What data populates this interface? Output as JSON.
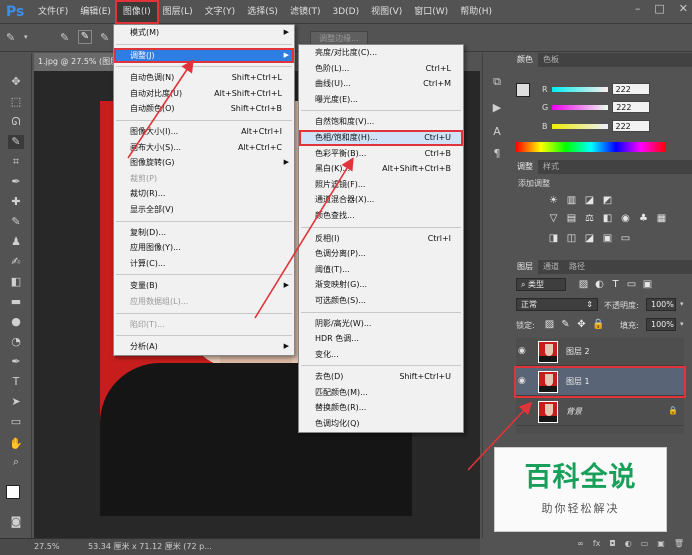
{
  "app": {
    "logo": "Ps"
  },
  "menubar": [
    "文件(F)",
    "编辑(E)",
    "图像(I)",
    "图层(L)",
    "文字(Y)",
    "选择(S)",
    "滤镜(T)",
    "3D(D)",
    "视图(V)",
    "窗口(W)",
    "帮助(H)"
  ],
  "window_controls": [
    "–",
    "□",
    "✕"
  ],
  "options": {
    "adjust_edge": "调整边缘..."
  },
  "document": {
    "tab_title": "1.jpg @ 27.5% (图层",
    "zoom": "27.5%",
    "doc_size": "53.34 厘米 x 71.12 厘米 (72 p..."
  },
  "image_menu": {
    "items": [
      {
        "label": "模式(M)",
        "arrow": true
      },
      {
        "sep": true
      },
      {
        "label": "调整(J)",
        "arrow": true,
        "highlighted": true
      },
      {
        "sep": true
      },
      {
        "label": "自动色调(N)",
        "shortcut": "Shift+Ctrl+L"
      },
      {
        "label": "自动对比度(U)",
        "shortcut": "Alt+Shift+Ctrl+L"
      },
      {
        "label": "自动颜色(O)",
        "shortcut": "Shift+Ctrl+B"
      },
      {
        "sep": true
      },
      {
        "label": "图像大小(I)...",
        "shortcut": "Alt+Ctrl+I"
      },
      {
        "label": "画布大小(S)...",
        "shortcut": "Alt+Ctrl+C"
      },
      {
        "label": "图像旋转(G)",
        "arrow": true
      },
      {
        "label": "裁剪(P)",
        "disabled": true
      },
      {
        "label": "裁切(R)..."
      },
      {
        "label": "显示全部(V)"
      },
      {
        "sep": true
      },
      {
        "label": "复制(D)..."
      },
      {
        "label": "应用图像(Y)..."
      },
      {
        "label": "计算(C)..."
      },
      {
        "sep": true
      },
      {
        "label": "变量(B)",
        "arrow": true
      },
      {
        "label": "应用数据组(L)...",
        "disabled": true
      },
      {
        "sep": true
      },
      {
        "label": "陷印(T)...",
        "disabled": true
      },
      {
        "sep": true
      },
      {
        "label": "分析(A)",
        "arrow": true
      }
    ]
  },
  "adjust_menu": {
    "items": [
      {
        "label": "亮度/对比度(C)..."
      },
      {
        "label": "色阶(L)...",
        "shortcut": "Ctrl+L"
      },
      {
        "label": "曲线(U)...",
        "shortcut": "Ctrl+M"
      },
      {
        "label": "曝光度(E)..."
      },
      {
        "sep": true
      },
      {
        "label": "自然饱和度(V)..."
      },
      {
        "label": "色相/饱和度(H)...",
        "shortcut": "Ctrl+U",
        "boxed": true
      },
      {
        "label": "色彩平衡(B)...",
        "shortcut": "Ctrl+B"
      },
      {
        "label": "黑白(K)...",
        "shortcut": "Alt+Shift+Ctrl+B"
      },
      {
        "label": "照片滤镜(F)..."
      },
      {
        "label": "通道混合器(X)..."
      },
      {
        "label": "颜色查找..."
      },
      {
        "sep": true
      },
      {
        "label": "反相(I)",
        "shortcut": "Ctrl+I"
      },
      {
        "label": "色调分离(P)..."
      },
      {
        "label": "阈值(T)..."
      },
      {
        "label": "渐变映射(G)..."
      },
      {
        "label": "可选颜色(S)..."
      },
      {
        "sep": true
      },
      {
        "label": "阴影/高光(W)..."
      },
      {
        "label": "HDR 色调..."
      },
      {
        "label": "变化..."
      },
      {
        "sep": true
      },
      {
        "label": "去色(D)",
        "shortcut": "Shift+Ctrl+U"
      },
      {
        "label": "匹配颜色(M)..."
      },
      {
        "label": "替换颜色(R)..."
      },
      {
        "label": "色调均化(Q)"
      }
    ]
  },
  "color_panel": {
    "tabs": [
      "颜色",
      "色板"
    ],
    "r_label": "R",
    "g_label": "G",
    "b_label": "B",
    "r": "222",
    "g": "222",
    "b": "222"
  },
  "adjust_panel": {
    "tabs": [
      "调整",
      "样式"
    ],
    "title": "添加调整"
  },
  "layers_panel": {
    "tabs": [
      "图层",
      "通道",
      "路径"
    ],
    "filter": "类型",
    "blend_mode": "正常",
    "opacity_label": "不透明度:",
    "opacity": "100%",
    "lock_label": "锁定:",
    "fill_label": "填充:",
    "fill": "100%",
    "layers": [
      {
        "name": "图层 2",
        "visible": true
      },
      {
        "name": "图层 1",
        "visible": true,
        "boxed": true
      },
      {
        "name": "背景",
        "visible": false,
        "locked": true
      }
    ],
    "footer_icons": [
      "∞",
      "fx",
      "◘",
      "◐",
      "▭",
      "▣",
      "🗑"
    ]
  },
  "watermark": {
    "title": "百科全说",
    "subtitle": "助你轻松解决"
  },
  "colors": {
    "highlight": "#2e7de2",
    "annotation": "#e0343a",
    "canvas_red": "#c81d1d"
  }
}
